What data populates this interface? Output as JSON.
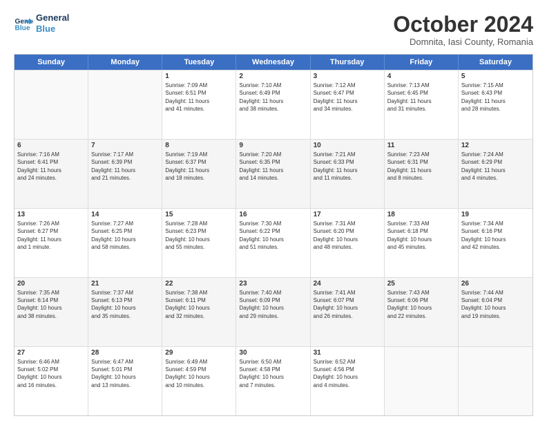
{
  "logo": {
    "line1": "General",
    "line2": "Blue"
  },
  "title": "October 2024",
  "subtitle": "Domnita, Iasi County, Romania",
  "header_days": [
    "Sunday",
    "Monday",
    "Tuesday",
    "Wednesday",
    "Thursday",
    "Friday",
    "Saturday"
  ],
  "rows": [
    [
      {
        "day": "",
        "text": "",
        "empty": true
      },
      {
        "day": "",
        "text": "",
        "empty": true
      },
      {
        "day": "1",
        "text": "Sunrise: 7:09 AM\nSunset: 6:51 PM\nDaylight: 11 hours\nand 41 minutes."
      },
      {
        "day": "2",
        "text": "Sunrise: 7:10 AM\nSunset: 6:49 PM\nDaylight: 11 hours\nand 38 minutes."
      },
      {
        "day": "3",
        "text": "Sunrise: 7:12 AM\nSunset: 6:47 PM\nDaylight: 11 hours\nand 34 minutes."
      },
      {
        "day": "4",
        "text": "Sunrise: 7:13 AM\nSunset: 6:45 PM\nDaylight: 11 hours\nand 31 minutes."
      },
      {
        "day": "5",
        "text": "Sunrise: 7:15 AM\nSunset: 6:43 PM\nDaylight: 11 hours\nand 28 minutes."
      }
    ],
    [
      {
        "day": "6",
        "text": "Sunrise: 7:16 AM\nSunset: 6:41 PM\nDaylight: 11 hours\nand 24 minutes."
      },
      {
        "day": "7",
        "text": "Sunrise: 7:17 AM\nSunset: 6:39 PM\nDaylight: 11 hours\nand 21 minutes."
      },
      {
        "day": "8",
        "text": "Sunrise: 7:19 AM\nSunset: 6:37 PM\nDaylight: 11 hours\nand 18 minutes."
      },
      {
        "day": "9",
        "text": "Sunrise: 7:20 AM\nSunset: 6:35 PM\nDaylight: 11 hours\nand 14 minutes."
      },
      {
        "day": "10",
        "text": "Sunrise: 7:21 AM\nSunset: 6:33 PM\nDaylight: 11 hours\nand 11 minutes."
      },
      {
        "day": "11",
        "text": "Sunrise: 7:23 AM\nSunset: 6:31 PM\nDaylight: 11 hours\nand 8 minutes."
      },
      {
        "day": "12",
        "text": "Sunrise: 7:24 AM\nSunset: 6:29 PM\nDaylight: 11 hours\nand 4 minutes."
      }
    ],
    [
      {
        "day": "13",
        "text": "Sunrise: 7:26 AM\nSunset: 6:27 PM\nDaylight: 11 hours\nand 1 minute."
      },
      {
        "day": "14",
        "text": "Sunrise: 7:27 AM\nSunset: 6:25 PM\nDaylight: 10 hours\nand 58 minutes."
      },
      {
        "day": "15",
        "text": "Sunrise: 7:28 AM\nSunset: 6:23 PM\nDaylight: 10 hours\nand 55 minutes."
      },
      {
        "day": "16",
        "text": "Sunrise: 7:30 AM\nSunset: 6:22 PM\nDaylight: 10 hours\nand 51 minutes."
      },
      {
        "day": "17",
        "text": "Sunrise: 7:31 AM\nSunset: 6:20 PM\nDaylight: 10 hours\nand 48 minutes."
      },
      {
        "day": "18",
        "text": "Sunrise: 7:33 AM\nSunset: 6:18 PM\nDaylight: 10 hours\nand 45 minutes."
      },
      {
        "day": "19",
        "text": "Sunrise: 7:34 AM\nSunset: 6:16 PM\nDaylight: 10 hours\nand 42 minutes."
      }
    ],
    [
      {
        "day": "20",
        "text": "Sunrise: 7:35 AM\nSunset: 6:14 PM\nDaylight: 10 hours\nand 38 minutes."
      },
      {
        "day": "21",
        "text": "Sunrise: 7:37 AM\nSunset: 6:13 PM\nDaylight: 10 hours\nand 35 minutes."
      },
      {
        "day": "22",
        "text": "Sunrise: 7:38 AM\nSunset: 6:11 PM\nDaylight: 10 hours\nand 32 minutes."
      },
      {
        "day": "23",
        "text": "Sunrise: 7:40 AM\nSunset: 6:09 PM\nDaylight: 10 hours\nand 29 minutes."
      },
      {
        "day": "24",
        "text": "Sunrise: 7:41 AM\nSunset: 6:07 PM\nDaylight: 10 hours\nand 26 minutes."
      },
      {
        "day": "25",
        "text": "Sunrise: 7:43 AM\nSunset: 6:06 PM\nDaylight: 10 hours\nand 22 minutes."
      },
      {
        "day": "26",
        "text": "Sunrise: 7:44 AM\nSunset: 6:04 PM\nDaylight: 10 hours\nand 19 minutes."
      }
    ],
    [
      {
        "day": "27",
        "text": "Sunrise: 6:46 AM\nSunset: 5:02 PM\nDaylight: 10 hours\nand 16 minutes."
      },
      {
        "day": "28",
        "text": "Sunrise: 6:47 AM\nSunset: 5:01 PM\nDaylight: 10 hours\nand 13 minutes."
      },
      {
        "day": "29",
        "text": "Sunrise: 6:49 AM\nSunset: 4:59 PM\nDaylight: 10 hours\nand 10 minutes."
      },
      {
        "day": "30",
        "text": "Sunrise: 6:50 AM\nSunset: 4:58 PM\nDaylight: 10 hours\nand 7 minutes."
      },
      {
        "day": "31",
        "text": "Sunrise: 6:52 AM\nSunset: 4:56 PM\nDaylight: 10 hours\nand 4 minutes."
      },
      {
        "day": "",
        "text": "",
        "empty": true
      },
      {
        "day": "",
        "text": "",
        "empty": true
      }
    ]
  ]
}
